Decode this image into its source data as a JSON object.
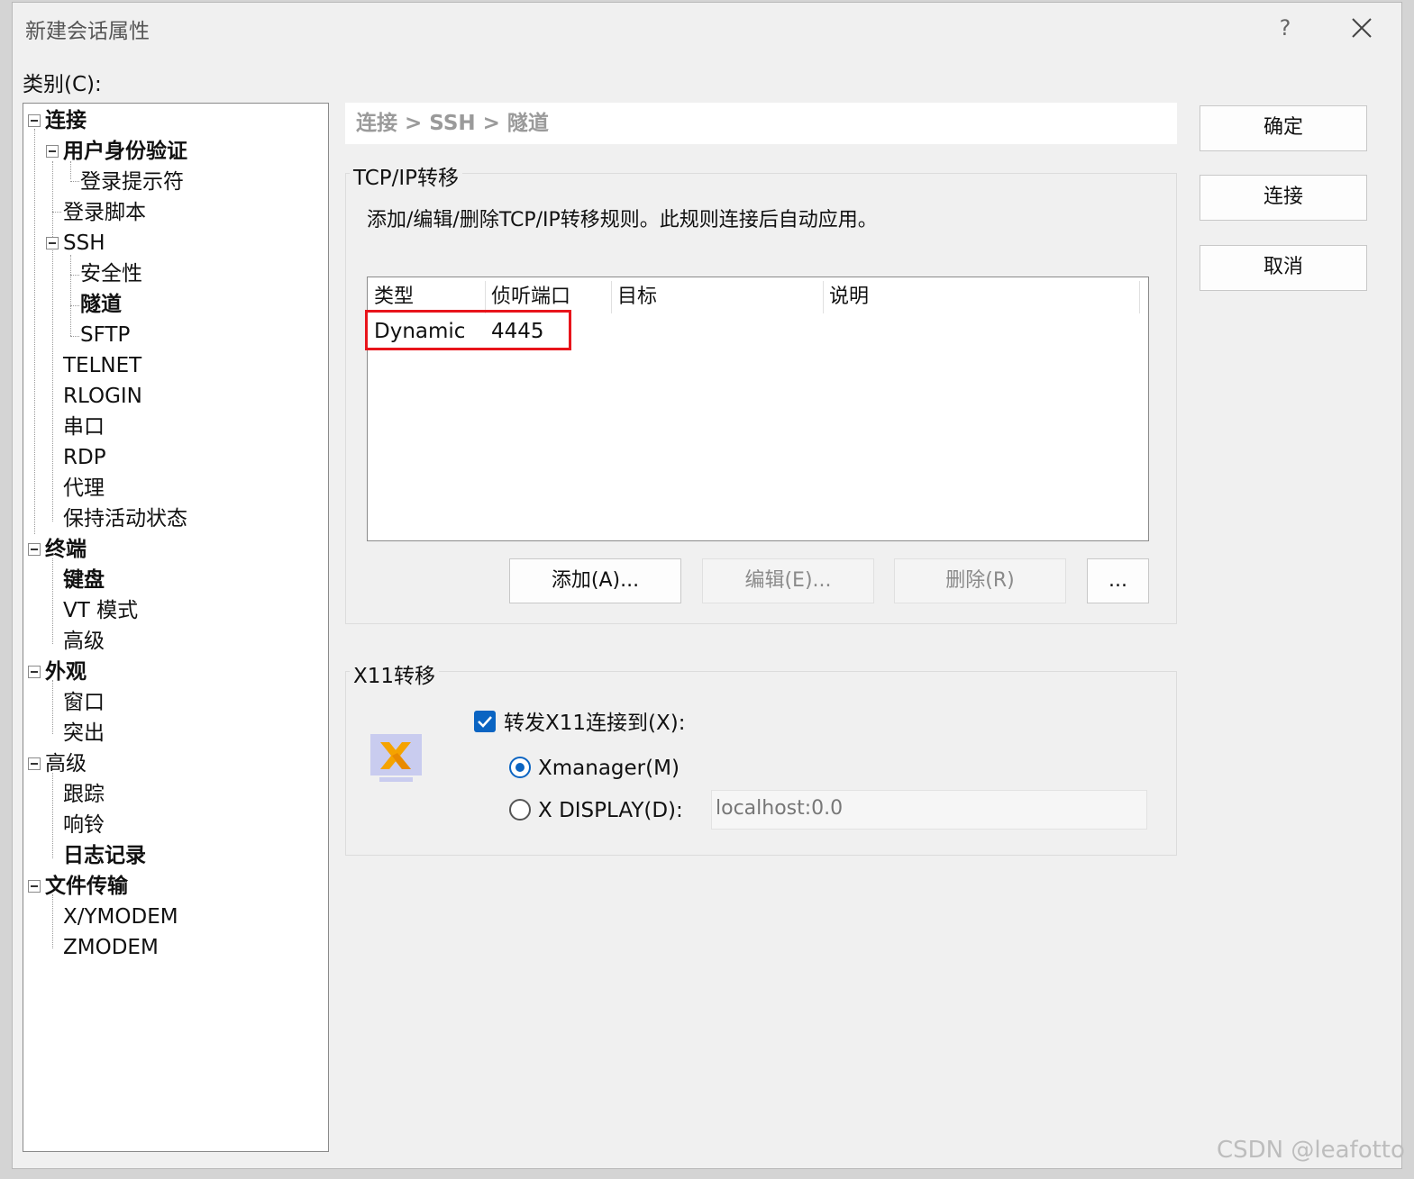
{
  "window": {
    "title": "新建会话属性",
    "help": "?",
    "close_icon": "close-icon"
  },
  "category_label": "类别(C):",
  "tree": {
    "connection": "连接",
    "auth": "用户身份验证",
    "login_prompt": "登录提示符",
    "login_script": "登录脚本",
    "ssh": "SSH",
    "security": "安全性",
    "tunnel": "隧道",
    "sftp": "SFTP",
    "telnet": "TELNET",
    "rlogin": "RLOGIN",
    "serial": "串口",
    "rdp": "RDP",
    "proxy": "代理",
    "keepalive": "保持活动状态",
    "terminal": "终端",
    "keyboard": "键盘",
    "vt_mode": "VT 模式",
    "term_advanced": "高级",
    "appearance": "外观",
    "window": "窗口",
    "highlight": "突出",
    "advanced": "高级",
    "trace": "跟踪",
    "bell": "响铃",
    "logging": "日志记录",
    "file_transfer": "文件传输",
    "xymodem": "X/YMODEM",
    "zmodem": "ZMODEM"
  },
  "breadcrumb": "连接 > SSH > 隧道",
  "tcp": {
    "title": "TCP/IP转移",
    "description": "添加/编辑/删除TCP/IP转移规则。此规则连接后自动应用。",
    "columns": [
      "类型",
      "侦听端口",
      "目标",
      "说明"
    ],
    "rows": [
      {
        "type": "Dynamic",
        "port": "4445",
        "target": "",
        "note": ""
      }
    ],
    "buttons": {
      "add": "添加(A)...",
      "edit": "编辑(E)...",
      "delete": "删除(R)",
      "more": "..."
    }
  },
  "x11": {
    "title": "X11转移",
    "forward_label": "转发X11连接到(X):",
    "forward_checked": true,
    "xmanager_label": "Xmanager(M)",
    "display_label": "X DISPLAY(D):",
    "display_value": "localhost:0.0",
    "selected": "xmanager"
  },
  "actions": {
    "ok": "确定",
    "connect": "连接",
    "cancel": "取消"
  },
  "watermark": "CSDN @leafotto",
  "colors": {
    "accent": "#0a64c2",
    "highlight_border": "#e8141b"
  }
}
